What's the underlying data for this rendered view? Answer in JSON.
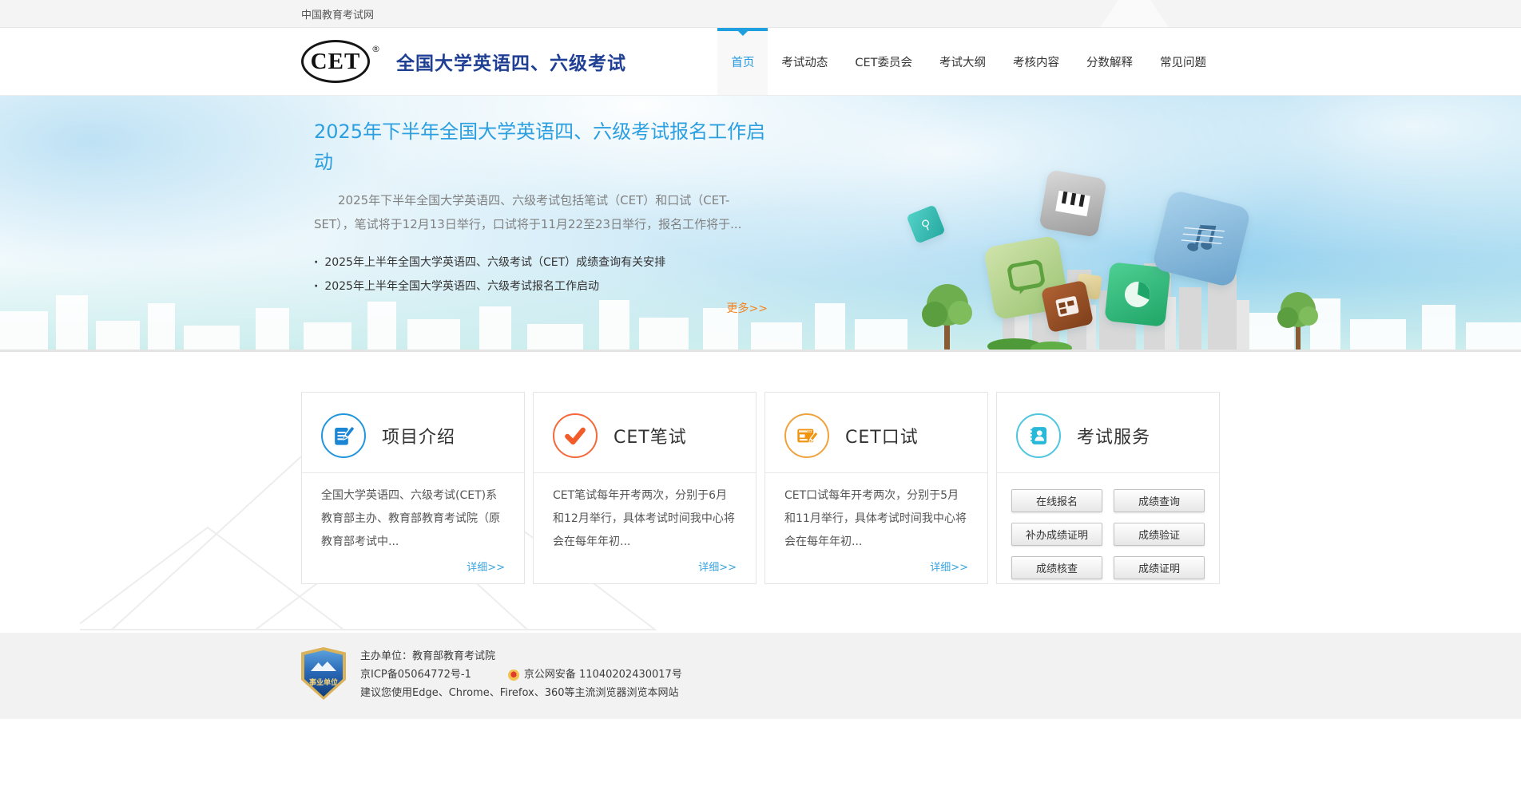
{
  "colors": {
    "accent_blue": "#2b9fe0",
    "brand_navy": "#1f3f94",
    "nav_active_blue": "#1e9fdf",
    "link_orange": "#f5821f",
    "card_icon_blue": "#1b87d4",
    "card_icon_red": "#f25b2a",
    "card_icon_amber": "#f0930f",
    "card_icon_cyan": "#29b8d8"
  },
  "topbar": {
    "site_name": "中国教育考试网"
  },
  "header": {
    "logo_text": "CET",
    "logo_reg": "®",
    "site_title": "全国大学英语四、六级考试",
    "nav": [
      {
        "label": "首页",
        "active": true
      },
      {
        "label": "考试动态",
        "active": false
      },
      {
        "label": "CET委员会",
        "active": false
      },
      {
        "label": "考试大纲",
        "active": false
      },
      {
        "label": "考核内容",
        "active": false
      },
      {
        "label": "分数解释",
        "active": false
      },
      {
        "label": "常见问题",
        "active": false
      }
    ]
  },
  "banner": {
    "headline": "2025年下半年全国大学英语四、六级考试报名工作启动",
    "summary": "2025年下半年全国大学英语四、六级考试包括笔试（CET）和口试（CET-SET），笔试将于12月13日举行，口试将于11月22至23日举行，报名工作将于...",
    "news": [
      "2025年上半年全国大学英语四、六级考试（CET）成绩查询有关安排",
      "2025年上半年全国大学英语四、六级考试报名工作启动"
    ],
    "more_label": "更多>>"
  },
  "cards": [
    {
      "title": "项目介绍",
      "icon": "document-pencil-icon",
      "text": "全国大学英语四、六级考试(CET)系教育部主办、教育部教育考试院（原教育部考试中...",
      "detail_label": "详细>>"
    },
    {
      "title": "CET笔试",
      "icon": "check-icon",
      "text": "CET笔试每年开考两次，分别于6月和12月举行，具体考试时间我中心将会在每年年初...",
      "detail_label": "详细>>"
    },
    {
      "title": "CET口试",
      "icon": "browser-pencil-icon",
      "text": "CET口试每年开考两次，分别于5月和11月举行，具体考试时间我中心将会在每年年初...",
      "detail_label": "详细>>"
    },
    {
      "title": "考试服务",
      "icon": "contact-book-icon",
      "buttons": [
        "在线报名",
        "成绩查询",
        "补办成绩证明",
        "成绩验证",
        "成绩核查",
        "成绩证明"
      ]
    }
  ],
  "footer": {
    "badge_label": "事业单位",
    "organizer": "主办单位：教育部教育考试院",
    "icp": "京ICP备05064772号-1",
    "police": "京公网安备 11040202430017号",
    "browser_tip": "建议您使用Edge、Chrome、Firefox、360等主流浏览器浏览本网站"
  }
}
